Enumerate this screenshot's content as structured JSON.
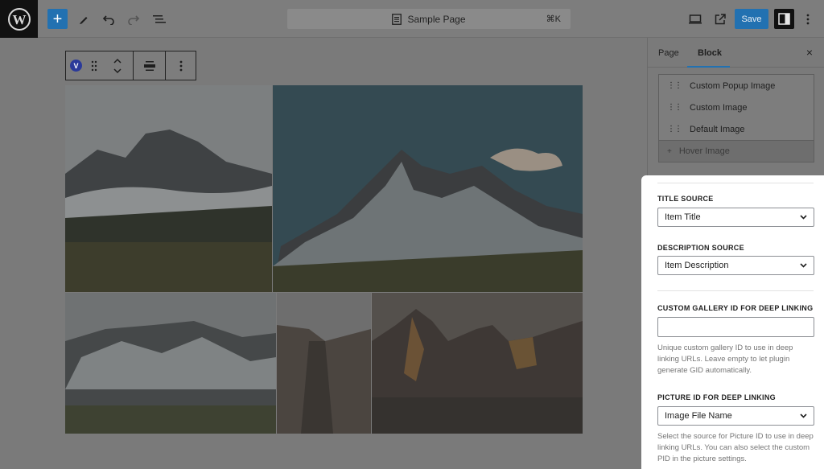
{
  "header": {
    "document_title": "Sample Page",
    "shortcut": "⌘K",
    "save_label": "Save"
  },
  "block_toolbar": {
    "badge_letter": "V"
  },
  "sidebar": {
    "tabs": [
      {
        "label": "Page",
        "active": false
      },
      {
        "label": "Block",
        "active": true
      }
    ],
    "close_symbol": "×",
    "image_types": [
      {
        "label": "Custom Popup Image"
      },
      {
        "label": "Custom Image"
      },
      {
        "label": "Default Image"
      }
    ],
    "add_item_label": "Hover Image"
  },
  "settings": {
    "title_source": {
      "label": "TITLE SOURCE",
      "value": "Item Title"
    },
    "description_source": {
      "label": "DESCRIPTION SOURCE",
      "value": "Item Description"
    },
    "gallery_id": {
      "label": "CUSTOM GALLERY ID FOR DEEP LINKING",
      "value": "",
      "help": "Unique custom gallery ID to use in deep linking URLs. Leave empty to let plugin generate GID automatically."
    },
    "picture_id": {
      "label": "PICTURE ID FOR DEEP LINKING",
      "value": "Image File Name",
      "help": "Select the source for Picture ID to use in deep linking URLs. You can also select the custom PID in the picture settings."
    }
  },
  "colors": {
    "accent": "#2271b1",
    "dim_overlay": "#7a7a7a",
    "panel_bg": "#ffffff"
  },
  "icons": {
    "logo": "wordpress-logo-icon",
    "add": "plus-icon",
    "tools": "pencil-icon",
    "undo": "undo-icon",
    "redo": "redo-icon",
    "outline": "list-view-icon",
    "document": "page-icon",
    "preview": "desktop-icon",
    "view_site": "external-link-icon",
    "settings": "sidebar-toggle-icon",
    "options": "vertical-dots-icon"
  }
}
